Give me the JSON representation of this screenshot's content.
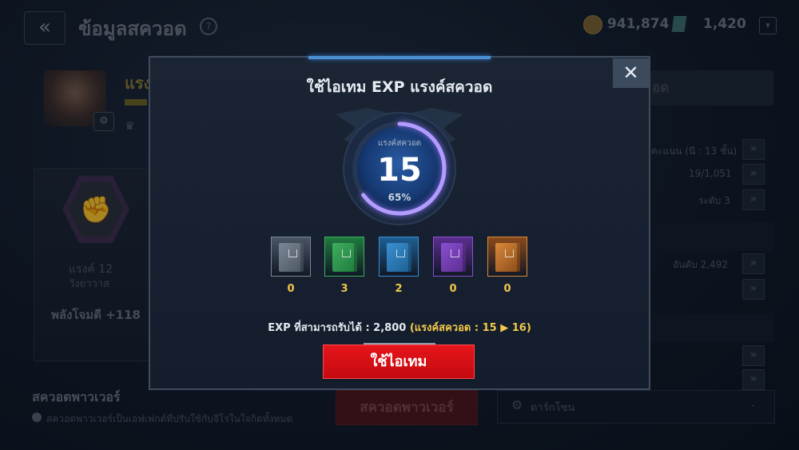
{
  "background": {
    "page_title": "ข้อมูลสควอด",
    "help_icon": "question-icon",
    "coins": "941,874",
    "gems": "1,420",
    "name_fragment": "แรง",
    "emblem_icon": "fist-icon",
    "rank_fragment_1": "แรงค์ 12",
    "rank_fragment_2": "วังยาวาส",
    "power_fragment": "พลังโจมตี +118",
    "top_right_button_fragment": "อด",
    "right_rows": [
      {
        "text": "คะแนน (นี : 13 ชั้น)"
      },
      {
        "text": "19/1,051"
      },
      {
        "text": "ระดับ 3"
      },
      {
        "text": "อันดับ 2,492"
      },
      {
        "text": "-"
      }
    ],
    "squad_power_title": "สควอดพาวเวอร์",
    "squad_power_desc": "สควอดพาวเวอร์เป็นเอฟเฟกต์ที่ปรับใช้กับจีโรในใจกิดทั้งหมด",
    "squad_power_button": "สควอดพาวเวอร์",
    "settings_label": "ดาร์กโซน",
    "settings_value": "-"
  },
  "modal": {
    "title": "ใช้ไอเทม EXP แรงค์สควอด",
    "close_icon": "close-icon",
    "gauge": {
      "label": "แรงค์สควอด",
      "value": "15",
      "percent_text": "65%",
      "progress_fraction": 0.65
    },
    "items": [
      {
        "icon": "exp-book-gray-icon",
        "color": "#4a5563",
        "border": "#7c8796",
        "count": "0"
      },
      {
        "icon": "exp-book-green-icon",
        "color": "#1f7a3f",
        "border": "#3fae5c",
        "count": "3"
      },
      {
        "icon": "exp-book-blue-icon",
        "color": "#1d5f93",
        "border": "#3b8fd0",
        "count": "2"
      },
      {
        "icon": "exp-book-purple-icon",
        "color": "#5b2d8f",
        "border": "#8a4fd0",
        "count": "0"
      },
      {
        "icon": "exp-book-orange-icon",
        "color": "#8a4a1a",
        "border": "#d98a3a",
        "count": "0"
      }
    ],
    "exp_text_prefix": "EXP ที่สามารถรับได้ : 2,800 ",
    "exp_text_highlight": "(แรงค์สควอด : 15 ▶ 16)",
    "use_button": "ใช้ไอเทม"
  },
  "colors": {
    "accent_red": "#e5151b",
    "highlight_yellow": "#f2c84b",
    "gauge_ring": "#a08cff"
  }
}
